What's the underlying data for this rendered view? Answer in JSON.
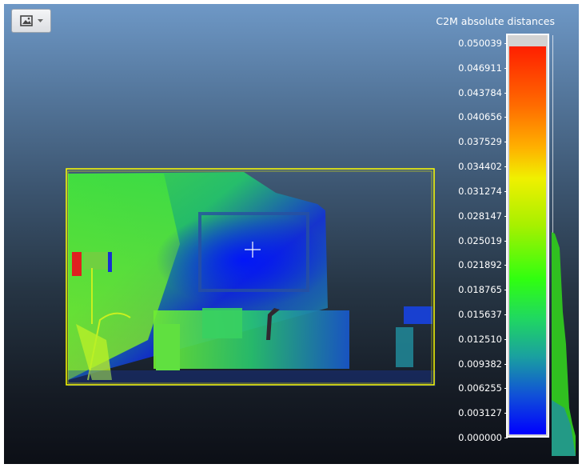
{
  "toolbar": {
    "view_button_icon": "image-icon",
    "dropdown_icon": "chevron-down-icon"
  },
  "scalar_field": {
    "title": "C2M absolute distances",
    "ticks": [
      "0.050039",
      "0.046911",
      "0.043784",
      "0.040656",
      "0.037529",
      "0.034402",
      "0.031274",
      "0.028147",
      "0.025019",
      "0.021892",
      "0.018765",
      "0.015637",
      "0.012510",
      "0.009382",
      "0.006255",
      "0.003127",
      "0.000000"
    ],
    "colors": {
      "high": "#ff1f00",
      "mid": "#f0f000",
      "low": "#0000ff",
      "nan": "#d3d3d3"
    }
  },
  "colors": {
    "bbox": "#ffff00",
    "background_top": "#6e98c6",
    "background_bottom": "#0c0f16"
  }
}
